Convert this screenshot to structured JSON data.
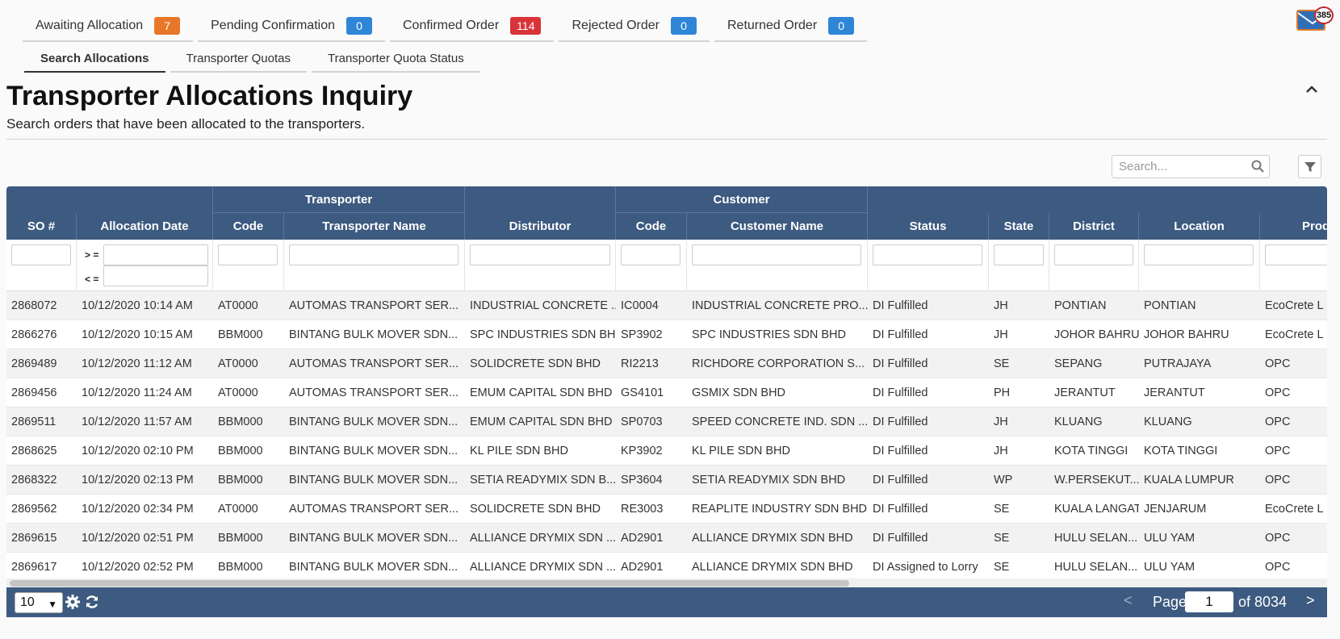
{
  "status_tabs": [
    {
      "label": "Awaiting Allocation",
      "count": "7",
      "color": "#e8772a"
    },
    {
      "label": "Pending Confirmation",
      "count": "0",
      "color": "#2f86d6"
    },
    {
      "label": "Confirmed Order",
      "count": "114",
      "color": "#d9333a"
    },
    {
      "label": "Rejected Order",
      "count": "0",
      "color": "#2f86d6"
    },
    {
      "label": "Returned Order",
      "count": "0",
      "color": "#2f86d6"
    }
  ],
  "sub_tabs": [
    "Search Allocations",
    "Transporter Quotas",
    "Transporter Quota Status"
  ],
  "mail": {
    "count": "385",
    "icon": "mail-icon"
  },
  "page": {
    "title": "Transporter Allocations Inquiry",
    "subtitle": "Search orders that have been allocated to the transporters.",
    "collapse_icon": "chevron-up-icon"
  },
  "search": {
    "placeholder": "Search..."
  },
  "grid": {
    "group_headers": {
      "transporter": "Transporter",
      "customer": "Customer"
    },
    "columns": [
      "SO #",
      "Allocation Date",
      "Code",
      "Transporter Name",
      "Distributor",
      "Code",
      "Customer Name",
      "Status",
      "State",
      "District",
      "Location",
      "Produ"
    ],
    "date_ops": {
      "gte": "> =",
      "lte": "< ="
    },
    "rows": [
      [
        "2868072",
        "10/12/2020 10:14 AM",
        "AT0000",
        "AUTOMAS TRANSPORT SER...",
        "INDUSTRIAL CONCRETE ...",
        "IC0004",
        "INDUSTRIAL CONCRETE PRO...",
        "DI Fulfilled",
        "JH",
        "PONTIAN",
        "PONTIAN",
        "EcoCrete L"
      ],
      [
        "2866276",
        "10/12/2020 10:15 AM",
        "BBM000",
        "BINTANG BULK MOVER SDN...",
        "SPC INDUSTRIES SDN BHD",
        "SP3902",
        "SPC INDUSTRIES SDN BHD",
        "DI Fulfilled",
        "JH",
        "JOHOR BAHRU",
        "JOHOR BAHRU",
        "EcoCrete L"
      ],
      [
        "2869489",
        "10/12/2020 11:12 AM",
        "AT0000",
        "AUTOMAS TRANSPORT SER...",
        "SOLIDCRETE SDN BHD",
        "RI2213",
        "RICHDORE CORPORATION S...",
        "DI Fulfilled",
        "SE",
        "SEPANG",
        "PUTRAJAYA",
        "OPC"
      ],
      [
        "2869456",
        "10/12/2020 11:24 AM",
        "AT0000",
        "AUTOMAS TRANSPORT SER...",
        "EMUM CAPITAL SDN BHD",
        "GS4101",
        "GSMIX SDN BHD",
        "DI Fulfilled",
        "PH",
        "JERANTUT",
        "JERANTUT",
        "OPC"
      ],
      [
        "2869511",
        "10/12/2020 11:57 AM",
        "BBM000",
        "BINTANG BULK MOVER SDN...",
        "EMUM CAPITAL SDN BHD",
        "SP0703",
        "SPEED CONCRETE IND. SDN ...",
        "DI Fulfilled",
        "JH",
        "KLUANG",
        "KLUANG",
        "OPC"
      ],
      [
        "2868625",
        "10/12/2020 02:10 PM",
        "BBM000",
        "BINTANG BULK MOVER SDN...",
        "KL PILE SDN BHD",
        "KP3902",
        "KL PILE SDN BHD",
        "DI Fulfilled",
        "JH",
        "KOTA TINGGI",
        "KOTA TINGGI",
        "OPC"
      ],
      [
        "2868322",
        "10/12/2020 02:13 PM",
        "BBM000",
        "BINTANG BULK MOVER SDN...",
        "SETIA READYMIX SDN B...",
        "SP3604",
        "SETIA READYMIX SDN BHD",
        "DI Fulfilled",
        "WP",
        "W.PERSEKUT...",
        "KUALA LUMPUR",
        "OPC"
      ],
      [
        "2869562",
        "10/12/2020 02:34 PM",
        "AT0000",
        "AUTOMAS TRANSPORT SER...",
        "SOLIDCRETE SDN BHD",
        "RE3003",
        "REAPLITE INDUSTRY SDN BHD",
        "DI Fulfilled",
        "SE",
        "KUALA LANGAT",
        "JENJARUM",
        "EcoCrete L"
      ],
      [
        "2869615",
        "10/12/2020 02:51 PM",
        "BBM000",
        "BINTANG BULK MOVER SDN...",
        "ALLIANCE DRYMIX SDN ...",
        "AD2901",
        "ALLIANCE DRYMIX SDN BHD",
        "DI Fulfilled",
        "SE",
        "HULU SELAN...",
        "ULU YAM",
        "OPC"
      ],
      [
        "2869617",
        "10/12/2020 02:52 PM",
        "BBM000",
        "BINTANG BULK MOVER SDN...",
        "ALLIANCE DRYMIX SDN ...",
        "AD2901",
        "ALLIANCE DRYMIX SDN BHD",
        "DI Assigned to Lorry",
        "SE",
        "HULU SELAN...",
        "ULU YAM",
        "OPC"
      ]
    ]
  },
  "footer": {
    "page_size": "10",
    "page_label": "Page",
    "page_value": "1",
    "page_of": "of 8034",
    "prev": "<",
    "next": ">"
  }
}
